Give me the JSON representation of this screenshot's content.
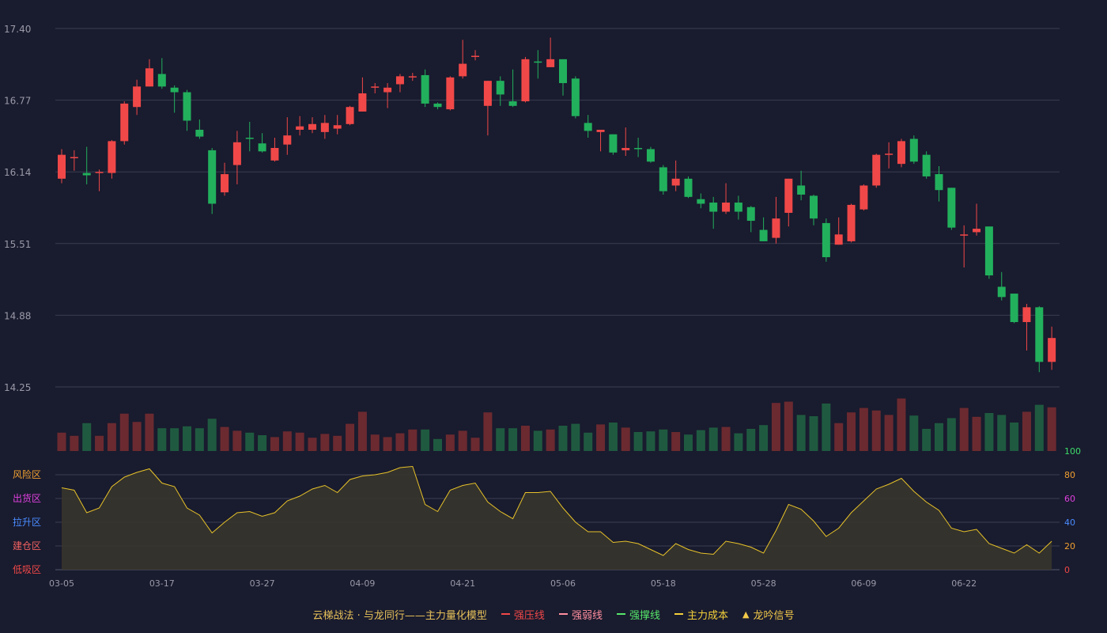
{
  "colors": {
    "background": "#191b2e",
    "up": "#f04848",
    "down": "#22b05d",
    "vol_up": "#6b2a30",
    "vol_down": "#1f5a40",
    "grid": "#3a3c50",
    "axis_text": "#9a9aa8",
    "indicator_line": "#e6c229",
    "indicator_fill": "#3a362c"
  },
  "chart_data": {
    "type": "candlestick",
    "price_axis_ticks": [
      "17.40",
      "16.77",
      "16.14",
      "15.51",
      "14.88",
      "14.25"
    ],
    "ylim": [
      14.25,
      17.4
    ],
    "date_ticks": [
      {
        "index": 0,
        "label": "03-05"
      },
      {
        "index": 8,
        "label": "03-17"
      },
      {
        "index": 16,
        "label": "03-27"
      },
      {
        "index": 24,
        "label": "04-09"
      },
      {
        "index": 32,
        "label": "04-21"
      },
      {
        "index": 40,
        "label": "05-06"
      },
      {
        "index": 48,
        "label": "05-18"
      },
      {
        "index": 56,
        "label": "05-28"
      },
      {
        "index": 64,
        "label": "06-09"
      },
      {
        "index": 72,
        "label": "06-22"
      }
    ],
    "candles": [
      [
        16.08,
        16.29,
        16.04,
        16.34
      ],
      [
        16.27,
        16.27,
        16.15,
        16.33
      ],
      [
        16.13,
        16.11,
        16.03,
        16.36
      ],
      [
        16.13,
        16.14,
        15.97,
        16.16
      ],
      [
        16.13,
        16.41,
        16.08,
        16.42
      ],
      [
        16.41,
        16.74,
        16.38,
        16.76
      ],
      [
        16.71,
        16.89,
        16.64,
        16.95
      ],
      [
        16.89,
        17.05,
        16.89,
        17.13
      ],
      [
        17.0,
        16.89,
        16.87,
        17.14
      ],
      [
        16.88,
        16.84,
        16.66,
        16.9
      ],
      [
        16.84,
        16.59,
        16.5,
        16.86
      ],
      [
        16.51,
        16.45,
        16.43,
        16.6
      ],
      [
        16.33,
        15.86,
        15.77,
        16.35
      ],
      [
        15.96,
        16.12,
        15.93,
        16.22
      ],
      [
        16.2,
        16.4,
        16.03,
        16.5
      ],
      [
        16.44,
        16.43,
        16.32,
        16.58
      ],
      [
        16.39,
        16.32,
        16.31,
        16.48
      ],
      [
        16.24,
        16.35,
        16.23,
        16.44
      ],
      [
        16.38,
        16.46,
        16.29,
        16.62
      ],
      [
        16.51,
        16.54,
        16.46,
        16.63
      ],
      [
        16.51,
        16.56,
        16.48,
        16.62
      ],
      [
        16.49,
        16.57,
        16.43,
        16.64
      ],
      [
        16.52,
        16.55,
        16.47,
        16.64
      ],
      [
        16.56,
        16.71,
        16.55,
        16.72
      ],
      [
        16.67,
        16.83,
        16.67,
        16.97
      ],
      [
        16.88,
        16.89,
        16.83,
        16.92
      ],
      [
        16.84,
        16.88,
        16.7,
        16.92
      ],
      [
        16.91,
        16.98,
        16.84,
        17.0
      ],
      [
        16.97,
        16.98,
        16.94,
        17.01
      ],
      [
        16.99,
        16.74,
        16.71,
        17.04
      ],
      [
        16.74,
        16.71,
        16.69,
        16.75
      ],
      [
        16.69,
        16.97,
        16.68,
        16.98
      ],
      [
        16.98,
        17.09,
        16.96,
        17.3
      ],
      [
        17.15,
        17.16,
        17.12,
        17.21
      ],
      [
        16.72,
        16.94,
        16.46,
        16.94
      ],
      [
        16.94,
        16.82,
        16.72,
        16.98
      ],
      [
        16.76,
        16.72,
        16.71,
        17.04
      ],
      [
        16.76,
        17.13,
        16.75,
        17.15
      ],
      [
        17.11,
        17.1,
        16.96,
        17.21
      ],
      [
        17.06,
        17.13,
        17.08,
        17.32
      ],
      [
        17.13,
        16.92,
        16.81,
        17.13
      ],
      [
        16.96,
        16.63,
        16.61,
        16.98
      ],
      [
        16.57,
        16.5,
        16.44,
        16.64
      ],
      [
        16.49,
        16.51,
        16.32,
        16.51
      ],
      [
        16.47,
        16.31,
        16.29,
        16.47
      ],
      [
        16.33,
        16.35,
        16.28,
        16.53
      ],
      [
        16.35,
        16.34,
        16.27,
        16.44
      ],
      [
        16.34,
        16.23,
        16.22,
        16.36
      ],
      [
        16.18,
        15.97,
        15.94,
        16.2
      ],
      [
        16.02,
        16.08,
        15.97,
        16.24
      ],
      [
        16.08,
        15.92,
        15.91,
        16.1
      ],
      [
        15.9,
        15.86,
        15.82,
        15.95
      ],
      [
        15.87,
        15.79,
        15.64,
        15.92
      ],
      [
        15.79,
        15.87,
        15.77,
        16.04
      ],
      [
        15.87,
        15.79,
        15.72,
        15.93
      ],
      [
        15.83,
        15.71,
        15.61,
        15.84
      ],
      [
        15.63,
        15.53,
        15.53,
        15.74
      ],
      [
        15.56,
        15.73,
        15.51,
        15.92
      ],
      [
        15.78,
        16.08,
        15.66,
        16.08
      ],
      [
        16.02,
        15.94,
        15.89,
        16.15
      ],
      [
        15.93,
        15.73,
        15.67,
        15.94
      ],
      [
        15.69,
        15.39,
        15.35,
        15.73
      ],
      [
        15.5,
        15.59,
        15.5,
        15.74
      ],
      [
        15.53,
        15.85,
        15.52,
        15.86
      ],
      [
        15.81,
        16.02,
        15.8,
        16.03
      ],
      [
        16.02,
        16.29,
        16.0,
        16.3
      ],
      [
        16.29,
        16.3,
        16.17,
        16.4
      ],
      [
        16.21,
        16.41,
        16.18,
        16.43
      ],
      [
        16.43,
        16.23,
        16.21,
        16.46
      ],
      [
        16.29,
        16.1,
        16.08,
        16.32
      ],
      [
        16.12,
        15.98,
        15.88,
        16.19
      ],
      [
        16.0,
        15.65,
        15.63,
        16.0
      ],
      [
        15.59,
        15.59,
        15.3,
        15.67
      ],
      [
        15.61,
        15.64,
        15.58,
        15.86
      ],
      [
        15.66,
        15.23,
        15.2,
        15.66
      ],
      [
        15.13,
        15.04,
        15.01,
        15.26
      ],
      [
        15.07,
        14.82,
        14.81,
        15.07
      ],
      [
        14.82,
        14.95,
        14.57,
        14.98
      ],
      [
        14.95,
        14.47,
        14.38,
        14.96
      ],
      [
        14.47,
        14.68,
        14.4,
        14.78
      ]
    ],
    "volume_rel": [
      0.29,
      0.24,
      0.44,
      0.24,
      0.44,
      0.59,
      0.46,
      0.59,
      0.36,
      0.36,
      0.39,
      0.36,
      0.51,
      0.38,
      0.32,
      0.29,
      0.25,
      0.22,
      0.31,
      0.29,
      0.21,
      0.27,
      0.24,
      0.43,
      0.62,
      0.26,
      0.22,
      0.28,
      0.34,
      0.34,
      0.19,
      0.26,
      0.32,
      0.21,
      0.61,
      0.36,
      0.36,
      0.4,
      0.32,
      0.34,
      0.4,
      0.43,
      0.29,
      0.42,
      0.45,
      0.37,
      0.3,
      0.31,
      0.34,
      0.3,
      0.26,
      0.33,
      0.37,
      0.38,
      0.28,
      0.35,
      0.41,
      0.76,
      0.78,
      0.57,
      0.55,
      0.75,
      0.44,
      0.61,
      0.68,
      0.64,
      0.57,
      0.83,
      0.56,
      0.35,
      0.44,
      0.52,
      0.68,
      0.54,
      0.6,
      0.57,
      0.45,
      0.62,
      0.73,
      0.69
    ],
    "indicator_axis_ticks": [
      "100",
      "80",
      "60",
      "40",
      "20",
      "0"
    ],
    "indicator_ylim": [
      0,
      100
    ],
    "zones": [
      "风险区",
      "出货区",
      "拉升区",
      "建仓区",
      "低吸区"
    ],
    "indicator": [
      69,
      67,
      48,
      52,
      70,
      78,
      82,
      85,
      73,
      70,
      52,
      46,
      31,
      40,
      48,
      49,
      45,
      48,
      58,
      62,
      68,
      71,
      65,
      76,
      79,
      80,
      82,
      86,
      87,
      55,
      49,
      67,
      71,
      73,
      57,
      49,
      43,
      65,
      65,
      66,
      52,
      40,
      32,
      32,
      23,
      24,
      22,
      17,
      12,
      22,
      17,
      14,
      13,
      24,
      22,
      19,
      14,
      33,
      55,
      51,
      41,
      28,
      35,
      48,
      58,
      68,
      72,
      77,
      66,
      57,
      50,
      35,
      32,
      34,
      22,
      18,
      14,
      21,
      14,
      24
    ]
  },
  "legend": [
    {
      "label": "云梯战法 · 与龙同行——主力量化模型",
      "color": "#e8c25a",
      "style": "none"
    },
    {
      "label": "强压线",
      "color": "#f04848",
      "style": "solid"
    },
    {
      "label": "强弱线",
      "color": "#ff8f9f",
      "style": "dashed"
    },
    {
      "label": "强撑线",
      "color": "#56e66a",
      "style": "solid"
    },
    {
      "label": "主力成本",
      "color": "#f3d03a",
      "style": "dashed"
    },
    {
      "label": "龙吟信号",
      "color": "#f3c94a",
      "style": "triangle"
    }
  ]
}
